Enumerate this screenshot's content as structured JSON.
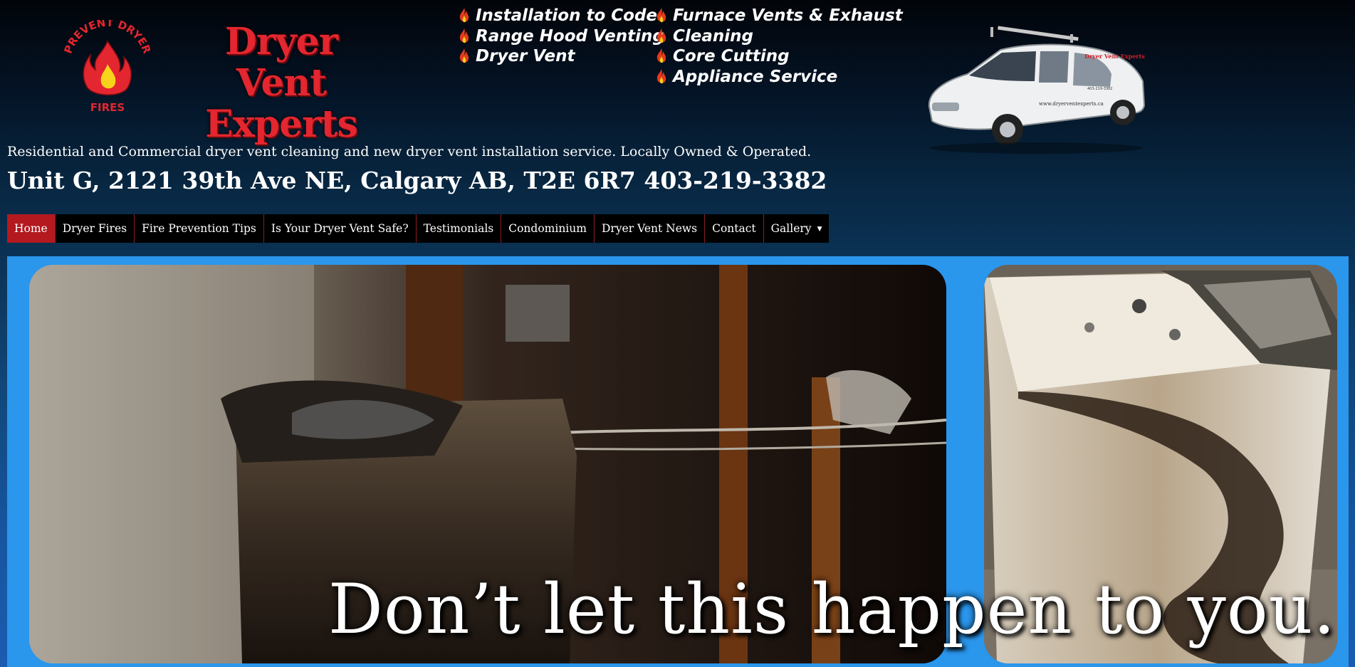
{
  "logo": {
    "badge_top_text": "PREVENT DRYER",
    "badge_bottom_text": "FIRES",
    "brand_line1": "Dryer Vent",
    "brand_line2": "Experts",
    "brand_color": "#e3262f"
  },
  "services": {
    "icon": "flame-icon",
    "column1": [
      "Installation to Code",
      "Range Hood Venting",
      "Dryer Vent"
    ],
    "column2": [
      "Furnace Vents & Exhaust",
      "Cleaning",
      "Core Cutting",
      "Appliance Service"
    ]
  },
  "van_image": {
    "icon": "service-van-image",
    "lettering": "Dryer Vent Experts",
    "phone": "403-219-3382",
    "website": "www.dryerventexperts.ca"
  },
  "tagline": "Residential and Commercial dryer vent cleaning and new dryer vent installation service. Locally Owned & Operated.",
  "address": "Unit G, 2121 39th Ave NE, Calgary AB, T2E 6R7 403-219-3382",
  "nav": {
    "items": [
      "Home",
      "Dryer Fires",
      "Fire Prevention Tips",
      "Is Your Dryer Vent Safe?",
      "Testimonials",
      "Condominium",
      "Dryer Vent News",
      "Contact",
      "Gallery"
    ],
    "active": "Home",
    "dropdown_icon": "caret-down-icon",
    "active_color": "#b3191f"
  },
  "hero": {
    "caption": "Don’t let this happen to you.",
    "background_color": "#2a96ec"
  }
}
